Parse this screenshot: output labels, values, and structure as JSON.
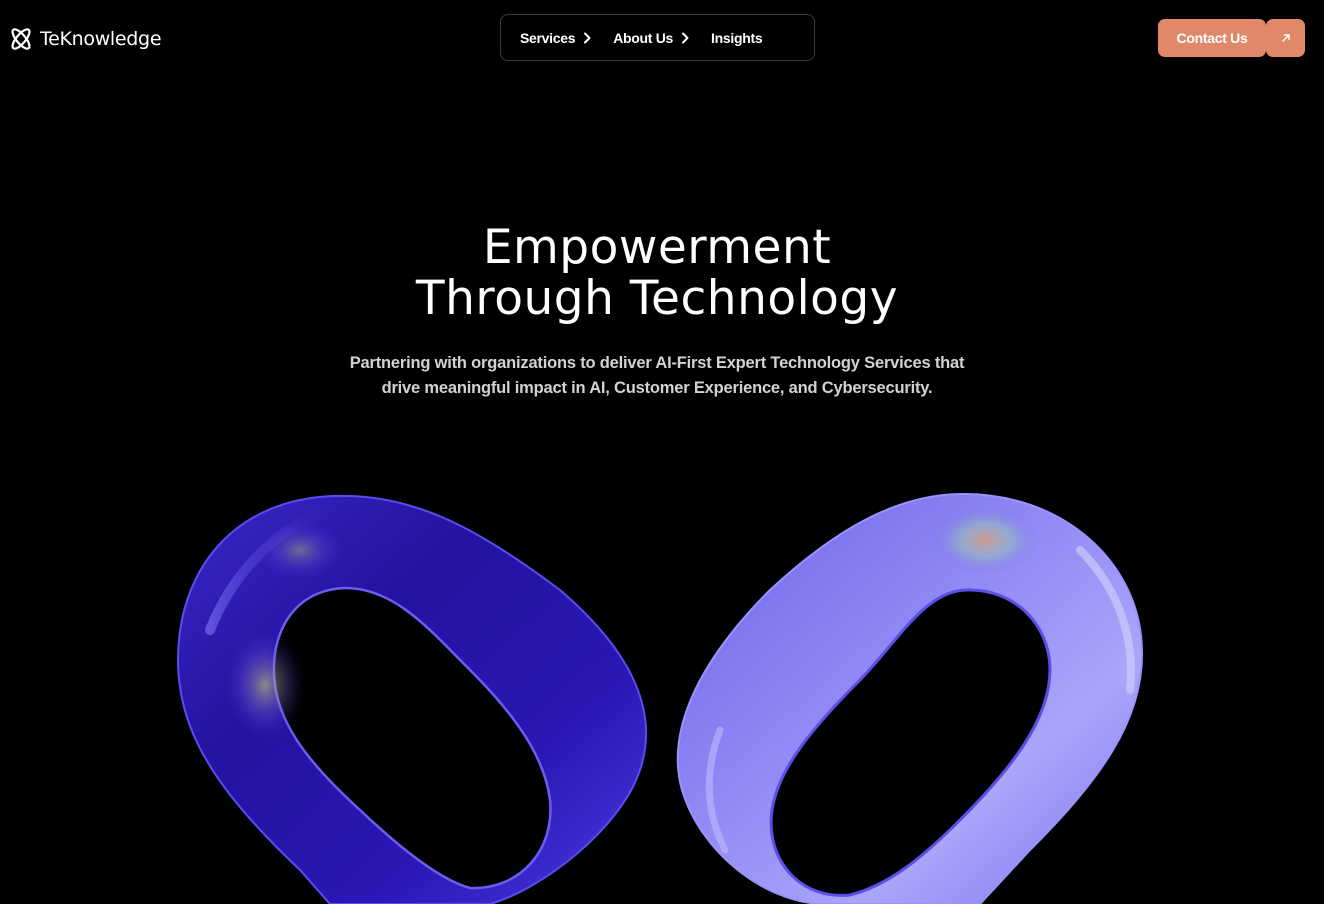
{
  "brand": {
    "name": "TeKnowledge",
    "icon": "teknowledge-logo-icon"
  },
  "nav": {
    "items": [
      {
        "label": "Services",
        "has_submenu": true
      },
      {
        "label": "About Us",
        "has_submenu": true
      },
      {
        "label": "Insights",
        "has_submenu": false
      }
    ]
  },
  "cta": {
    "label": "Contact Us",
    "icon": "arrow-up-right-icon",
    "color": "#e0896a"
  },
  "hero": {
    "title_line1": "Empowerment",
    "title_line2": "Through Technology",
    "subtitle_line1": "Partnering with organizations to deliver AI-First Expert Technology Services that",
    "subtitle_line2": "drive meaningful impact in AI, Customer Experience, and Cybersecurity.",
    "art": "glass-infinity-loops",
    "accent_colors": [
      "#2a17a8",
      "#8d85f2"
    ]
  }
}
